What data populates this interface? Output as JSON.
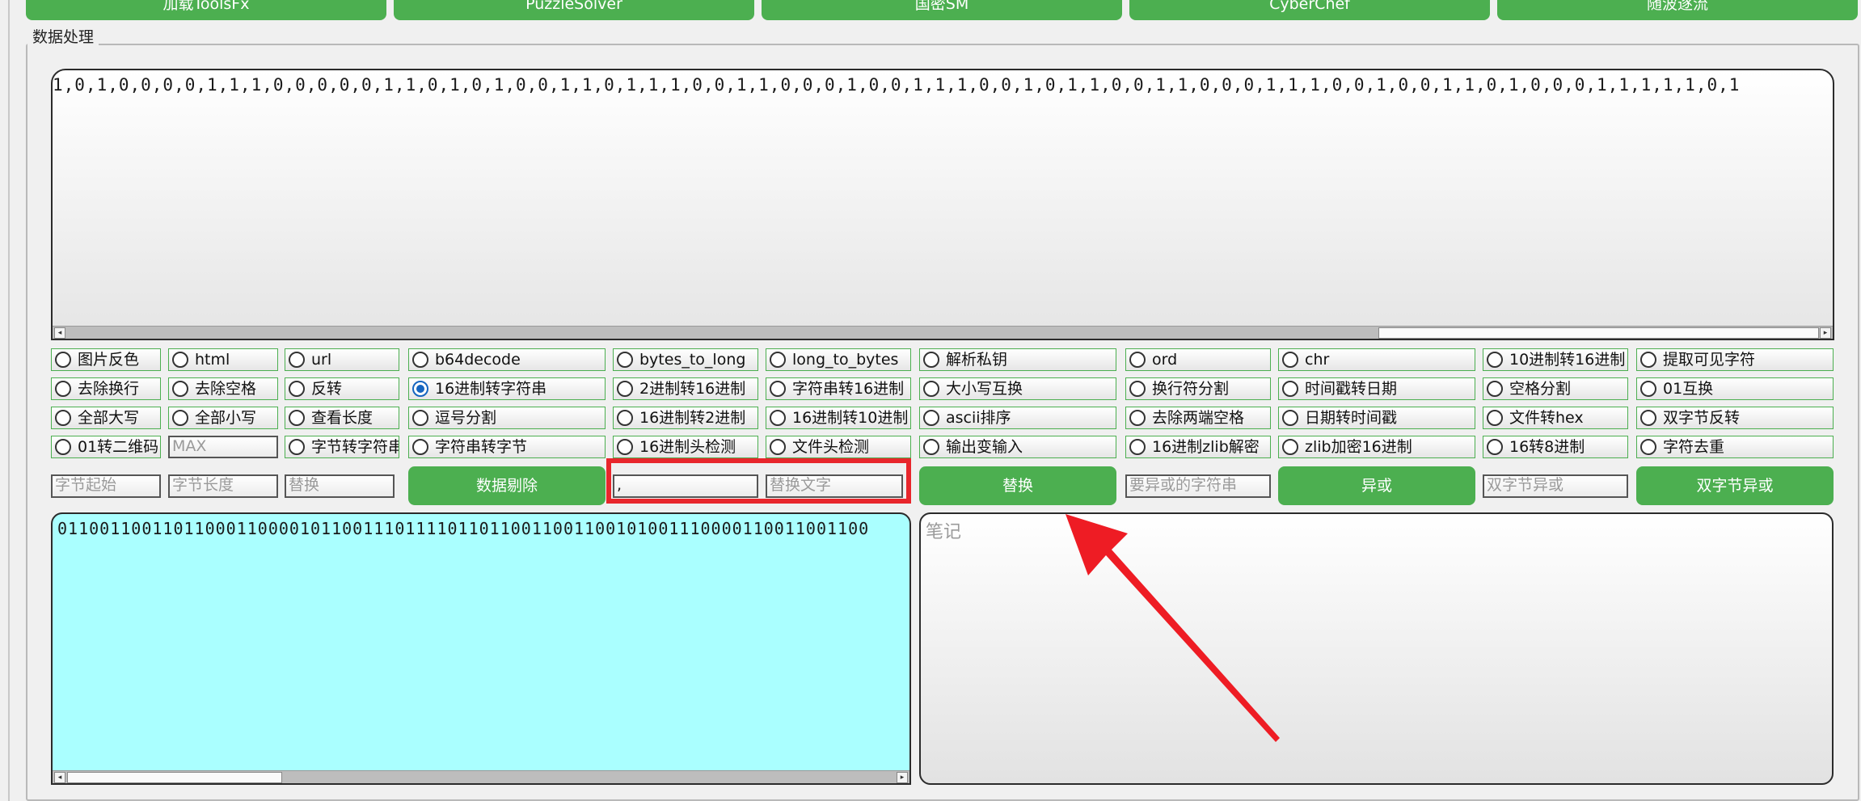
{
  "top_buttons": [
    "加载ToolsFx",
    "PuzzleSolver",
    "国密SM",
    "CyberChef",
    "随波逐流"
  ],
  "group_label": "数据处理",
  "top_text": "1,0,1,0,0,0,0,1,1,1,0,0,0,0,0,1,1,0,1,0,1,0,0,1,1,0,1,1,1,0,0,1,1,0,0,0,1,0,0,1,1,1,0,0,1,0,1,1,0,0,1,1,0,0,0,1,1,1,0,0,1,0,0,1,1,0,1,0,0,0,1,1,1,1,1,0,1",
  "options": [
    "图片反色",
    "html",
    "url",
    "b64decode",
    "bytes_to_long",
    "long_to_bytes",
    "解析私钥",
    "ord",
    "chr",
    "10进制转16进制",
    "提取可见字符",
    "去除换行",
    "去除空格",
    "反转",
    "16进制转字符串",
    "2进制转16进制",
    "字符串转16进制",
    "大小写互换",
    "换行符分割",
    "时间戳转日期",
    "空格分割",
    "01互换",
    "全部大写",
    "全部小写",
    "查看长度",
    "逗号分割",
    "16进制转2进制",
    "16进制转10进制",
    "ascii排序",
    "去除两端空格",
    "日期转时间戳",
    "文件转hex",
    "双字节反转",
    "01转二维码",
    "字节转字符串",
    "字符串转字节",
    "16进制头检测",
    "文件头检测",
    "输出变输入",
    "16进制zlib解密",
    "zlib加密16进制",
    "16转8进制",
    "字符去重"
  ],
  "max_placeholder": "MAX",
  "inputs": {
    "byte_start": "字节起始",
    "byte_length": "字节长度",
    "replace1": "替换",
    "find_value": ",",
    "replace_text": "替换文字",
    "xor_string": "要异或的字符串",
    "double_xor": "双字节异或"
  },
  "buttons": {
    "data_remove": "数据剔除",
    "replace": "替换",
    "xor": "异或",
    "double_xor": "双字节异或"
  },
  "output_text": "01100110011011000110000101100111011110110110011001100101001110000110011001100",
  "notes_placeholder": "笔记",
  "colors": {
    "green": "#4caf50",
    "output_bg": "#aaffff",
    "highlight": "#e8262c"
  }
}
